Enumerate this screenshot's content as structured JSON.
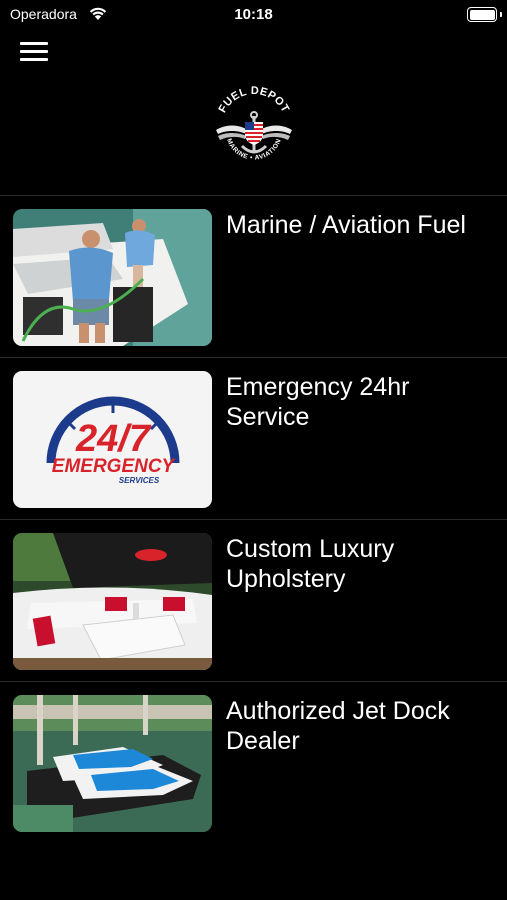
{
  "status_bar": {
    "carrier": "Operadora",
    "time": "10:18"
  },
  "header": {
    "menu_icon": "hamburger-menu-icon",
    "logo": {
      "top_text": "FUEL DEPOT",
      "bottom_text": "MARINE • AVIATION"
    }
  },
  "services": [
    {
      "title": "Marine / Aviation Fuel",
      "image": "boat-fueling-photo"
    },
    {
      "title": "Emergency 24hr Service",
      "image": "emergency-24-7-logo",
      "badge_main": "24/7",
      "badge_line1": "EMERGENCY",
      "badge_line2": "SERVICES"
    },
    {
      "title": "Custom Luxury Upholstery",
      "image": "boat-interior-upholstery-photo"
    },
    {
      "title": "Authorized Jet Dock Dealer",
      "image": "jet-ski-dock-photo"
    }
  ],
  "colors": {
    "background": "#000000",
    "emergency_red": "#d8232a",
    "emergency_blue": "#1d3b8c"
  }
}
